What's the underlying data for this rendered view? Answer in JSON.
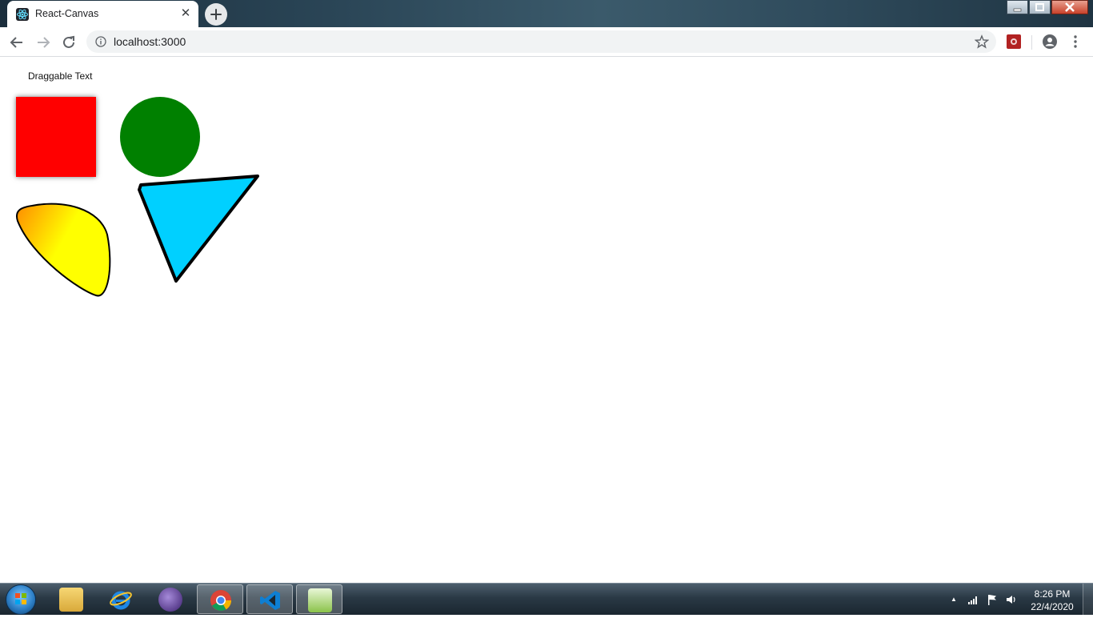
{
  "browser": {
    "tab_title": "React-Canvas",
    "tab_close_glyph": "✕",
    "new_tab_glyph": "+",
    "address": "localhost:3000"
  },
  "page": {
    "draggable_text": "Draggable Text",
    "shapes": {
      "square_color": "#ff0000",
      "circle_color": "#008000",
      "triangle_color": "#00d0ff",
      "blob_gradient": [
        "#ff8c00",
        "#ffff00"
      ]
    }
  },
  "taskbar": {
    "time": "8:26 PM",
    "date": "22/4/2020",
    "tray_up_glyph": "▲"
  }
}
